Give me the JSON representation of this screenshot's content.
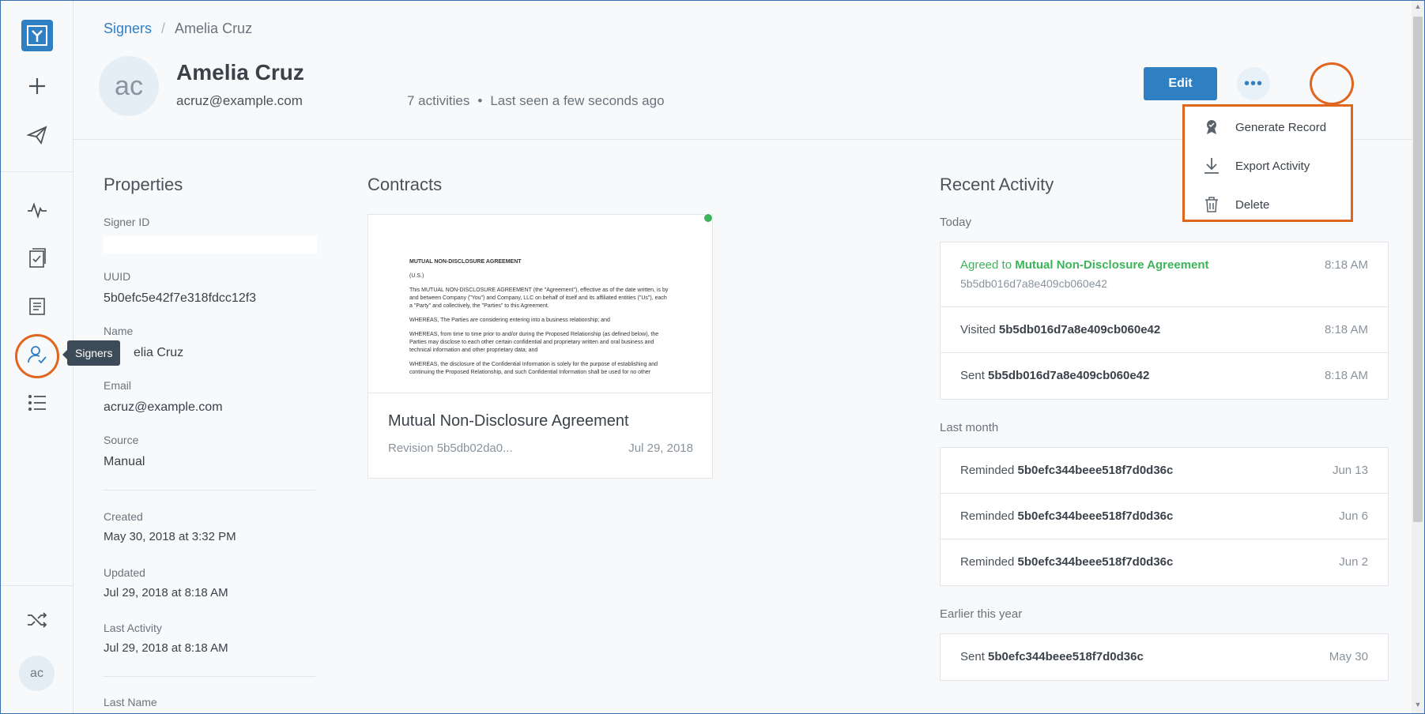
{
  "sidebar": {
    "tooltip": "Signers",
    "avatar_initials": "ac"
  },
  "breadcrumb": {
    "parent": "Signers",
    "current": "Amelia Cruz"
  },
  "header": {
    "avatar_initials": "ac",
    "name": "Amelia Cruz",
    "email": "acruz@example.com",
    "activities": "7 activities",
    "dot": "•",
    "last_seen": "Last seen a few seconds ago",
    "edit_label": "Edit",
    "more_label": "•••"
  },
  "menu": {
    "items": [
      {
        "label": "Generate Record"
      },
      {
        "label": "Export Activity"
      },
      {
        "label": "Delete"
      }
    ]
  },
  "properties": {
    "title": "Properties",
    "signer_id_label": "Signer ID",
    "uuid_label": "UUID",
    "uuid": "5b0efc5e42f7e318fdcc12f3",
    "name_label": "Name",
    "name": "elia Cruz",
    "email_label": "Email",
    "email": "acruz@example.com",
    "source_label": "Source",
    "source": "Manual",
    "created_label": "Created",
    "created": "May 30, 2018 at 3:32 PM",
    "updated_label": "Updated",
    "updated": "Jul 29, 2018 at 8:18 AM",
    "last_activity_label": "Last Activity",
    "last_activity": "Jul 29, 2018 at 8:18 AM",
    "last_name_label": "Last Name"
  },
  "contracts": {
    "title": "Contracts",
    "card": {
      "title": "Mutual Non-Disclosure Agreement",
      "revision": "Revision 5b5db02da0...",
      "date": "Jul 29, 2018",
      "doc": {
        "heading": "MUTUAL NON-DISCLOSURE AGREEMENT",
        "sub": "(U.S.)",
        "p1": "This MUTUAL NON-DISCLOSURE AGREEMENT (the \"Agreement\"), effective as of the date written, is by and between Company (\"You\") and Company, LLC on behalf of itself and its affiliated entities (\"Us\"), each a \"Party\" and collectively, the \"Parties\" to this Agreement.",
        "p2": "WHEREAS, The Parties are considering entering into a business relationship; and",
        "p3": "WHEREAS, from time to time prior to and/or during the Proposed Relationship (as defined below), the Parties may disclose to each other certain confidential and proprietary written and oral business and technical information and other proprietary data; and",
        "p4": "WHEREAS, the disclosure of the Confidential Information is solely for the purpose of establishing and continuing the Proposed Relationship, and such Confidential Information shall be used for no other"
      }
    }
  },
  "activity": {
    "title": "Recent Activity",
    "today_label": "Today",
    "today": [
      {
        "prefix": "Agreed to ",
        "bold": "Mutual Non-Disclosure Agreement",
        "sub": "5b5db016d7a8e409cb060e42",
        "time": "8:18 AM"
      },
      {
        "prefix": "Visited ",
        "bold": "5b5db016d7a8e409cb060e42",
        "time": "8:18 AM"
      },
      {
        "prefix": "Sent ",
        "bold": "5b5db016d7a8e409cb060e42",
        "time": "8:18 AM"
      }
    ],
    "last_month_label": "Last month",
    "last_month": [
      {
        "prefix": "Reminded ",
        "bold": "5b0efc344beee518f7d0d36c",
        "time": "Jun 13"
      },
      {
        "prefix": "Reminded ",
        "bold": "5b0efc344beee518f7d0d36c",
        "time": "Jun 6"
      },
      {
        "prefix": "Reminded ",
        "bold": "5b0efc344beee518f7d0d36c",
        "time": "Jun 2"
      }
    ],
    "earlier_label": "Earlier this year",
    "earlier": [
      {
        "prefix": "Sent ",
        "bold": "5b0efc344beee518f7d0d36c",
        "time": "May 30"
      }
    ]
  },
  "colors": {
    "accent": "#2f7fc3",
    "highlight": "#e0651f",
    "success": "#3db45a"
  }
}
